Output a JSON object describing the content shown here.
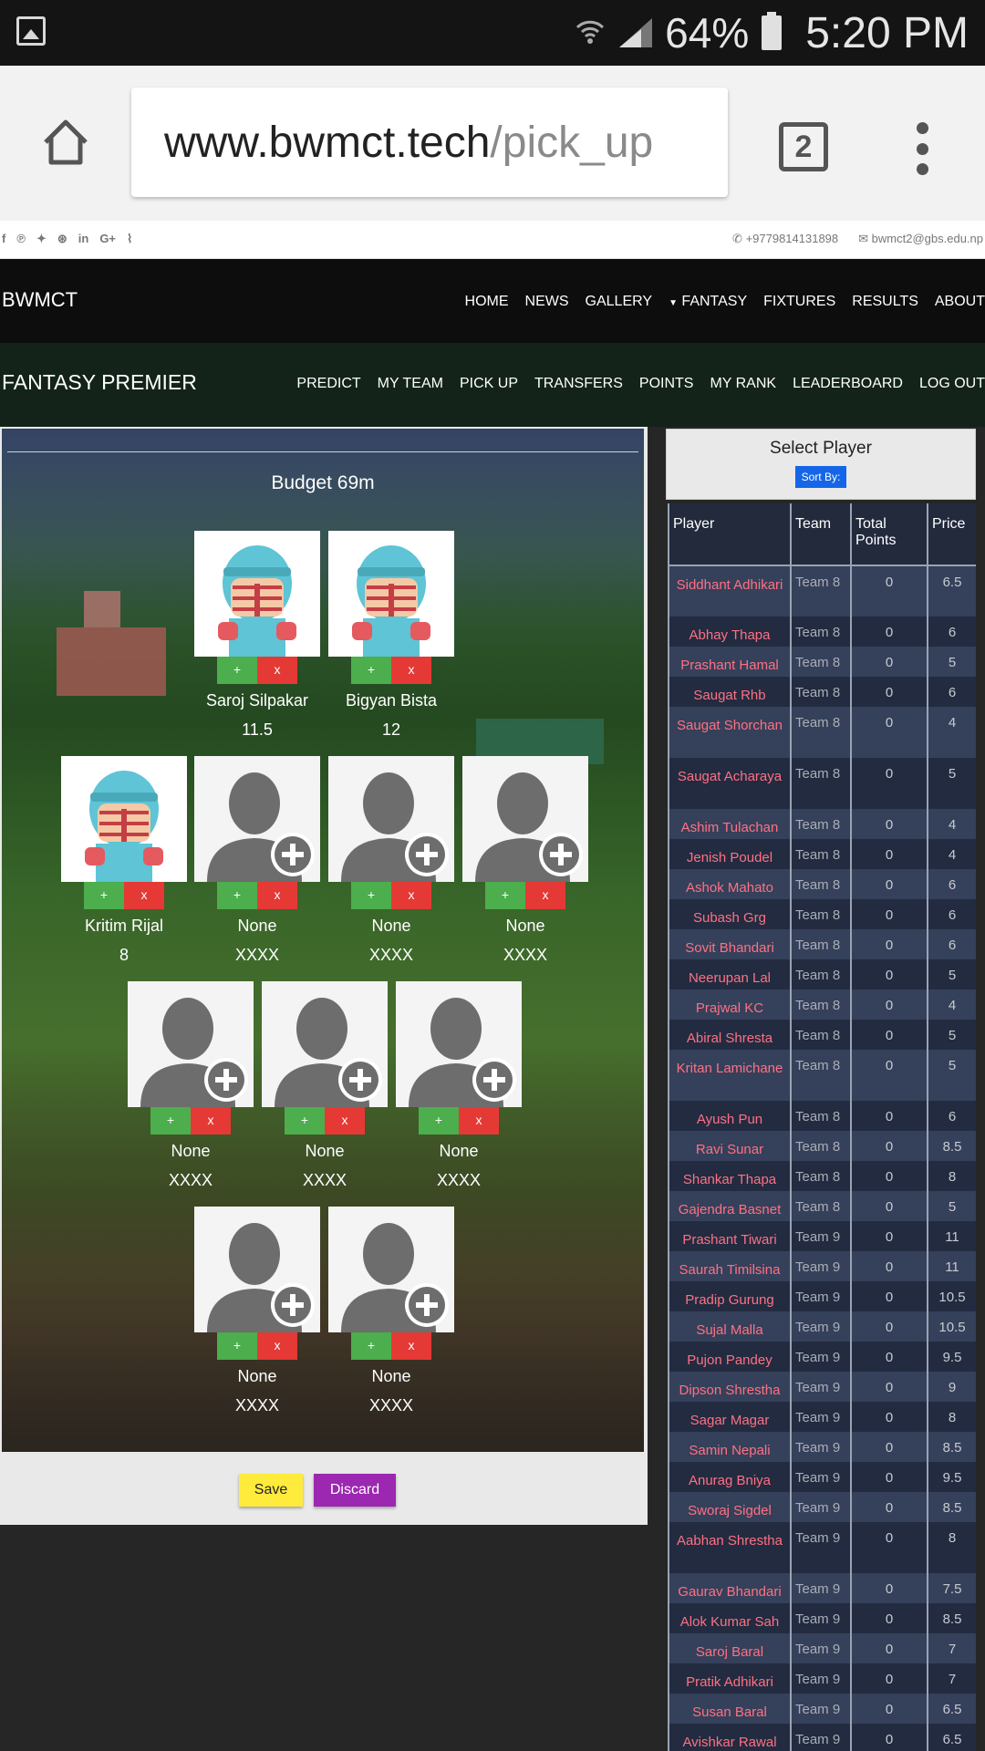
{
  "status_bar": {
    "battery": "64%",
    "time": "5:20 PM"
  },
  "browser": {
    "url_host": "www.bwmct.tech",
    "url_path": "/pick_up",
    "tab_count": "2"
  },
  "topbar": {
    "phone": "+9779814131898",
    "email": "bwmct2@gbs.edu.np"
  },
  "navbar": {
    "brand": "BWMCT",
    "items": [
      "HOME",
      "NEWS",
      "GALLERY",
      "FANTASY",
      "FIXTURES",
      "RESULTS",
      "ABOUT"
    ]
  },
  "subnav": {
    "brand": "FANTASY PREMIER",
    "items": [
      "PREDICT",
      "MY TEAM",
      "PICK UP",
      "TRANSFERS",
      "POINTS",
      "MY RANK",
      "LEADERBOARD",
      "LOG OUT"
    ]
  },
  "pitch": {
    "budget": "Budget 69m",
    "add_label": "+",
    "remove_label": "x",
    "slots": [
      {
        "name": "Saroj Silpakar",
        "price": "11.5",
        "filled": true
      },
      {
        "name": "Bigyan Bista",
        "price": "12",
        "filled": true
      },
      {
        "name": "Kritim Rijal",
        "price": "8",
        "filled": true
      },
      {
        "name": "None",
        "price": "XXXX",
        "filled": false
      },
      {
        "name": "None",
        "price": "XXXX",
        "filled": false
      },
      {
        "name": "None",
        "price": "XXXX",
        "filled": false
      },
      {
        "name": "None",
        "price": "XXXX",
        "filled": false
      },
      {
        "name": "None",
        "price": "XXXX",
        "filled": false
      },
      {
        "name": "None",
        "price": "XXXX",
        "filled": false
      },
      {
        "name": "None",
        "price": "XXXX",
        "filled": false
      },
      {
        "name": "None",
        "price": "XXXX",
        "filled": false
      }
    ],
    "save_label": "Save",
    "discard_label": "Discard"
  },
  "select_player": {
    "title": "Select Player",
    "sort_label": "Sort By:",
    "columns": [
      "Player",
      "Team",
      "Total Points",
      "Price"
    ],
    "rows": [
      [
        "Siddhant Adhikari",
        "Team 8",
        "0",
        "6.5"
      ],
      [
        "Abhay Thapa",
        "Team 8",
        "0",
        "6"
      ],
      [
        "Prashant Hamal",
        "Team 8",
        "0",
        "5"
      ],
      [
        "Saugat Rhb",
        "Team 8",
        "0",
        "6"
      ],
      [
        "Saugat Shorchan",
        "Team 8",
        "0",
        "4"
      ],
      [
        "Saugat Acharaya",
        "Team 8",
        "0",
        "5"
      ],
      [
        "Ashim Tulachan",
        "Team 8",
        "0",
        "4"
      ],
      [
        "Jenish Poudel",
        "Team 8",
        "0",
        "4"
      ],
      [
        "Ashok Mahato",
        "Team 8",
        "0",
        "6"
      ],
      [
        "Subash Grg",
        "Team 8",
        "0",
        "6"
      ],
      [
        "Sovit Bhandari",
        "Team 8",
        "0",
        "6"
      ],
      [
        "Neerupan Lal",
        "Team 8",
        "0",
        "5"
      ],
      [
        "Prajwal KC",
        "Team 8",
        "0",
        "4"
      ],
      [
        "Abiral Shresta",
        "Team 8",
        "0",
        "5"
      ],
      [
        "Kritan Lamichane",
        "Team 8",
        "0",
        "5"
      ],
      [
        "Ayush Pun",
        "Team 8",
        "0",
        "6"
      ],
      [
        "Ravi Sunar",
        "Team 8",
        "0",
        "8.5"
      ],
      [
        "Shankar Thapa",
        "Team 8",
        "0",
        "8"
      ],
      [
        "Gajendra Basnet",
        "Team 8",
        "0",
        "5"
      ],
      [
        "Prashant Tiwari",
        "Team 9",
        "0",
        "11"
      ],
      [
        "Saurah Timilsina",
        "Team 9",
        "0",
        "11"
      ],
      [
        "Pradip Gurung",
        "Team 9",
        "0",
        "10.5"
      ],
      [
        "Sujal Malla",
        "Team 9",
        "0",
        "10.5"
      ],
      [
        "Pujon Pandey",
        "Team 9",
        "0",
        "9.5"
      ],
      [
        "Dipson Shrestha",
        "Team 9",
        "0",
        "9"
      ],
      [
        "Sagar Magar",
        "Team 9",
        "0",
        "8"
      ],
      [
        "Samin Nepali",
        "Team 9",
        "0",
        "8.5"
      ],
      [
        "Anurag Bniya",
        "Team 9",
        "0",
        "9.5"
      ],
      [
        "Sworaj Sigdel",
        "Team 9",
        "0",
        "8.5"
      ],
      [
        "Aabhan Shrestha",
        "Team 9",
        "0",
        "8"
      ],
      [
        "Gaurav Bhandari",
        "Team 9",
        "0",
        "7.5"
      ],
      [
        "Alok Kumar Sah",
        "Team 9",
        "0",
        "8.5"
      ],
      [
        "Saroj Baral",
        "Team 9",
        "0",
        "7"
      ],
      [
        "Pratik Adhikari",
        "Team 9",
        "0",
        "7"
      ],
      [
        "Susan Baral",
        "Team 9",
        "0",
        "6.5"
      ],
      [
        "Avishkar Rawal",
        "Team 9",
        "0",
        "6.5"
      ]
    ]
  }
}
